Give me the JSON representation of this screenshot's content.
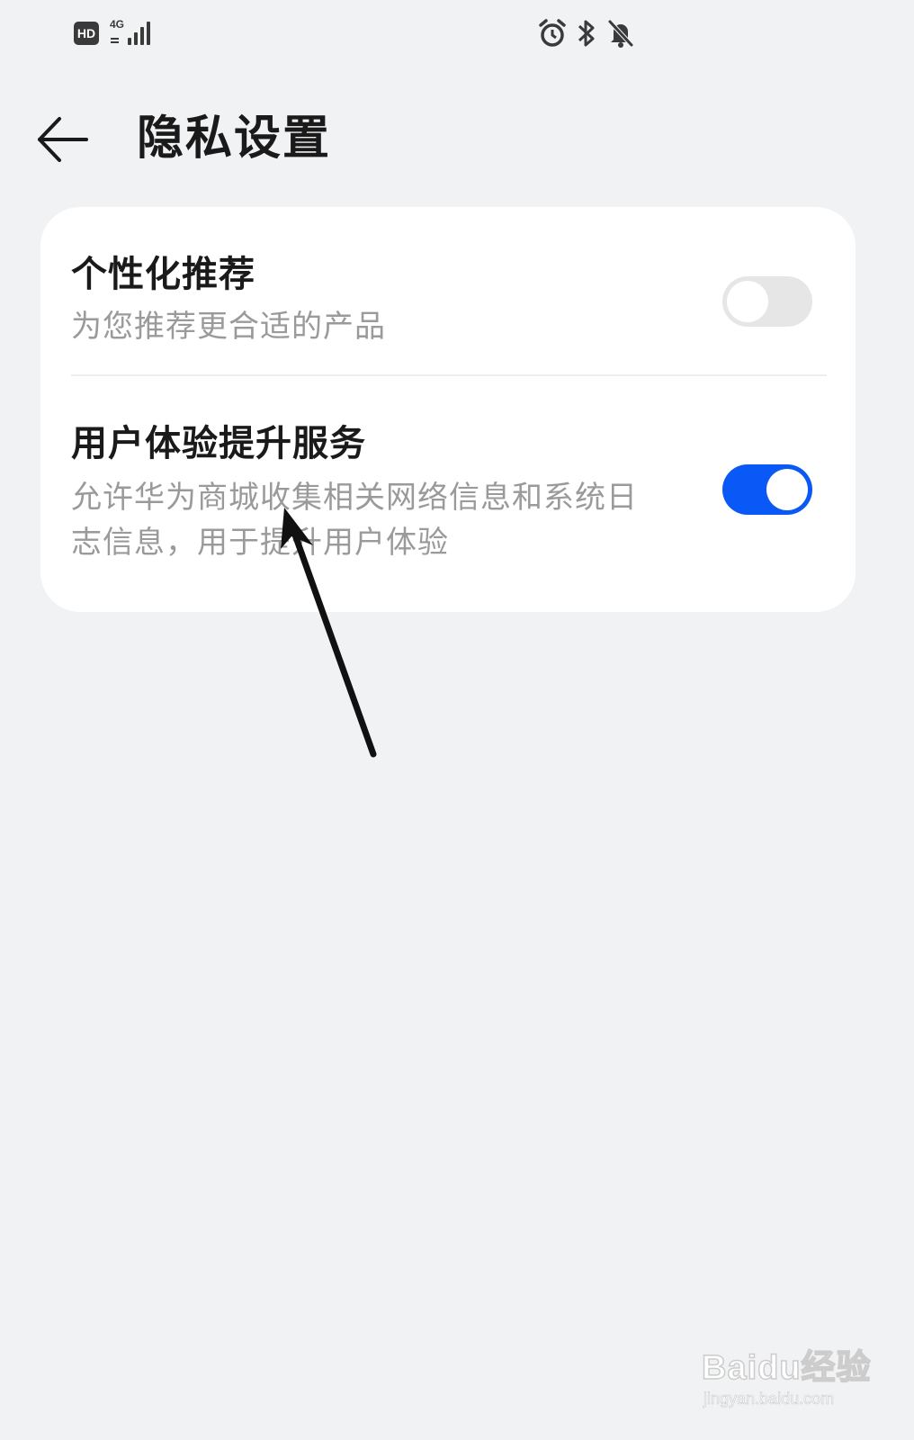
{
  "status_bar": {
    "hd_label": "HD",
    "network_type": "4G",
    "icons": [
      "signal-icon",
      "alarm-icon",
      "bluetooth-icon",
      "bell-off-icon"
    ]
  },
  "header": {
    "title": "隐私设置",
    "back_icon": "back-arrow-icon"
  },
  "settings": [
    {
      "title": "个性化推荐",
      "subtitle": "为您推荐更合适的产品",
      "enabled": false
    },
    {
      "title": "用户体验提升服务",
      "subtitle": "允许华为商城收集相关网络信息和系统日志信息，用于提升用户体验",
      "enabled": true
    }
  ],
  "colors": {
    "background": "#f1f2f4",
    "card": "#ffffff",
    "toggle_on": "#0a59f7",
    "toggle_off": "#e6e6e6",
    "primary_text": "#1a1a1a",
    "secondary_text": "#9a9a9a"
  },
  "watermark": {
    "logo": "Baidu经验",
    "url": "jingyan.baidu.com"
  }
}
